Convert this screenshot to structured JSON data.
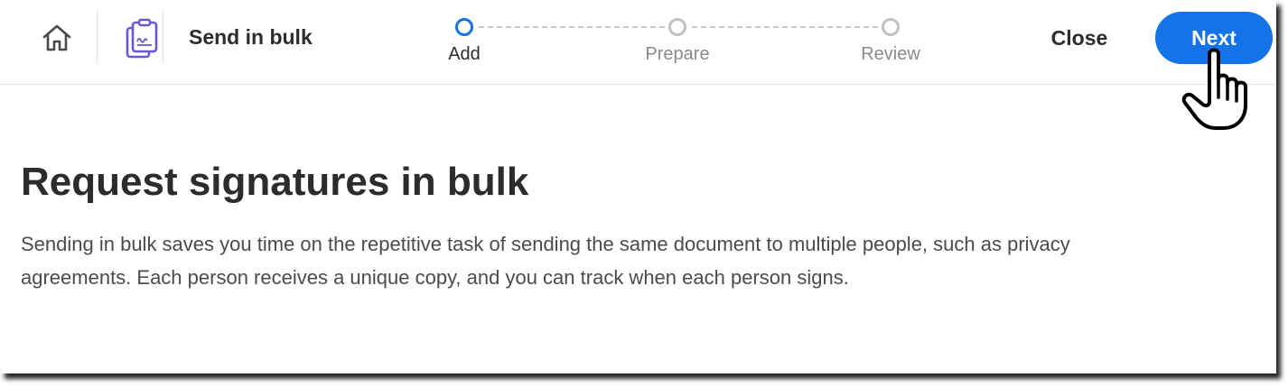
{
  "header": {
    "app_title": "Send in bulk",
    "home_icon": "home-icon",
    "app_icon": "bulk-signature-document-icon",
    "close_label": "Close",
    "next_label": "Next"
  },
  "stepper": {
    "steps": [
      {
        "label": "Add",
        "state": "active"
      },
      {
        "label": "Prepare",
        "state": "inactive"
      },
      {
        "label": "Review",
        "state": "inactive"
      }
    ]
  },
  "main": {
    "title": "Request signatures in bulk",
    "description": "Sending in bulk saves you time on the repetitive task of sending the same document to multiple people, such as privacy agreements. Each person receives a unique copy, and you can track when each person signs."
  },
  "colors": {
    "accent": "#1473e6",
    "app_icon": "#6e55d6",
    "inactive_step": "#c2c2c2",
    "text": "#2c2c2c"
  },
  "cursor_icon": "hand-pointer-icon"
}
